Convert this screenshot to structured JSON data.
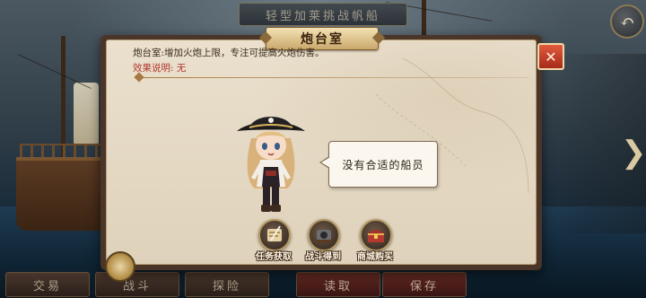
{
  "header": {
    "ship_title": "轻型加莱挑战帆船"
  },
  "dialog": {
    "title": "炮台室",
    "description": "炮台室:增加火炮上限，专注可提高火炮伤害。",
    "effect": "效果说明: 无"
  },
  "speech_bubble": {
    "text": "没有合适的船员"
  },
  "actions": [
    {
      "label": "任务获取",
      "icon": "scroll-quill-icon"
    },
    {
      "label": "战斗得到",
      "icon": "cannon-icon"
    },
    {
      "label": "商城购买",
      "icon": "treasure-chest-icon"
    }
  ],
  "bottom_tabs": [
    {
      "label": "交易"
    },
    {
      "label": "战斗"
    },
    {
      "label": "探险"
    },
    {
      "label": "读取"
    },
    {
      "label": "保存"
    }
  ],
  "colors": {
    "accent_red": "#b2352a",
    "parchment": "#e6dcc8",
    "frame": "#4a3528"
  }
}
